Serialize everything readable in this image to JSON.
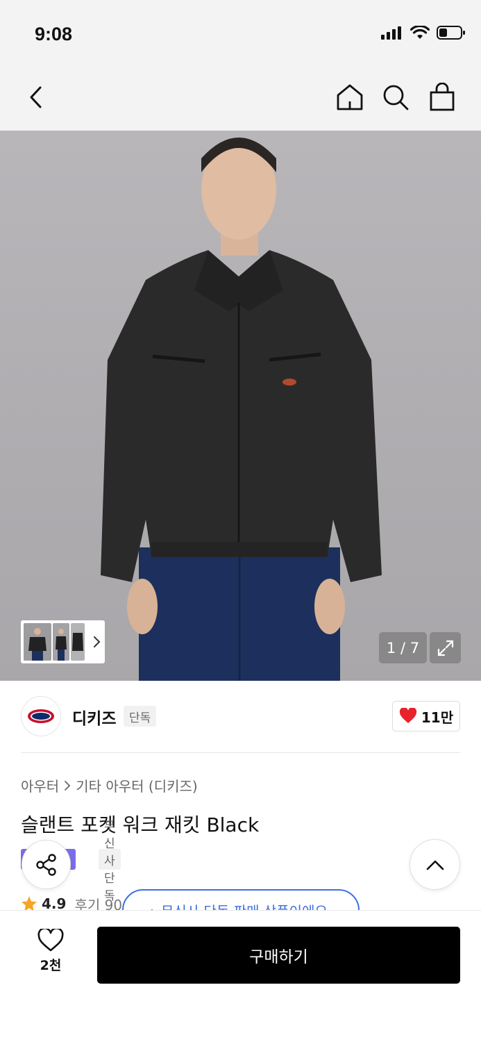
{
  "status_bar": {
    "time": "9:08"
  },
  "nav": {
    "icons": [
      "back-icon",
      "home-icon",
      "search-icon",
      "shopping-bag-icon"
    ]
  },
  "gallery": {
    "counter": "1 / 7",
    "thumb_more_icon": "chevron-right-icon",
    "expand_icon": "expand-icon"
  },
  "brand": {
    "name": "디키즈",
    "tag": "단독",
    "likes": "11만",
    "logo_text": "Dickies"
  },
  "breadcrumb": {
    "category": "아우터",
    "subcategory": "기타 아우터 (디키즈)"
  },
  "product": {
    "title": "슬랜트 포켓 워크 재킷 Black"
  },
  "badges": {
    "grey": "무신사단독"
  },
  "rating": {
    "score": "4.9",
    "reviews": "후기 90"
  },
  "exclusive_pill": {
    "text": "무신사 단독 판매 상품이에요"
  },
  "bottom": {
    "wish_count": "2천",
    "buy_label": "구매하기"
  },
  "colors": {
    "accent_blue": "#3b6fe0",
    "heart_red": "#e8212b",
    "badge_purple": "#7b6ce8",
    "star": "#f5a623"
  }
}
